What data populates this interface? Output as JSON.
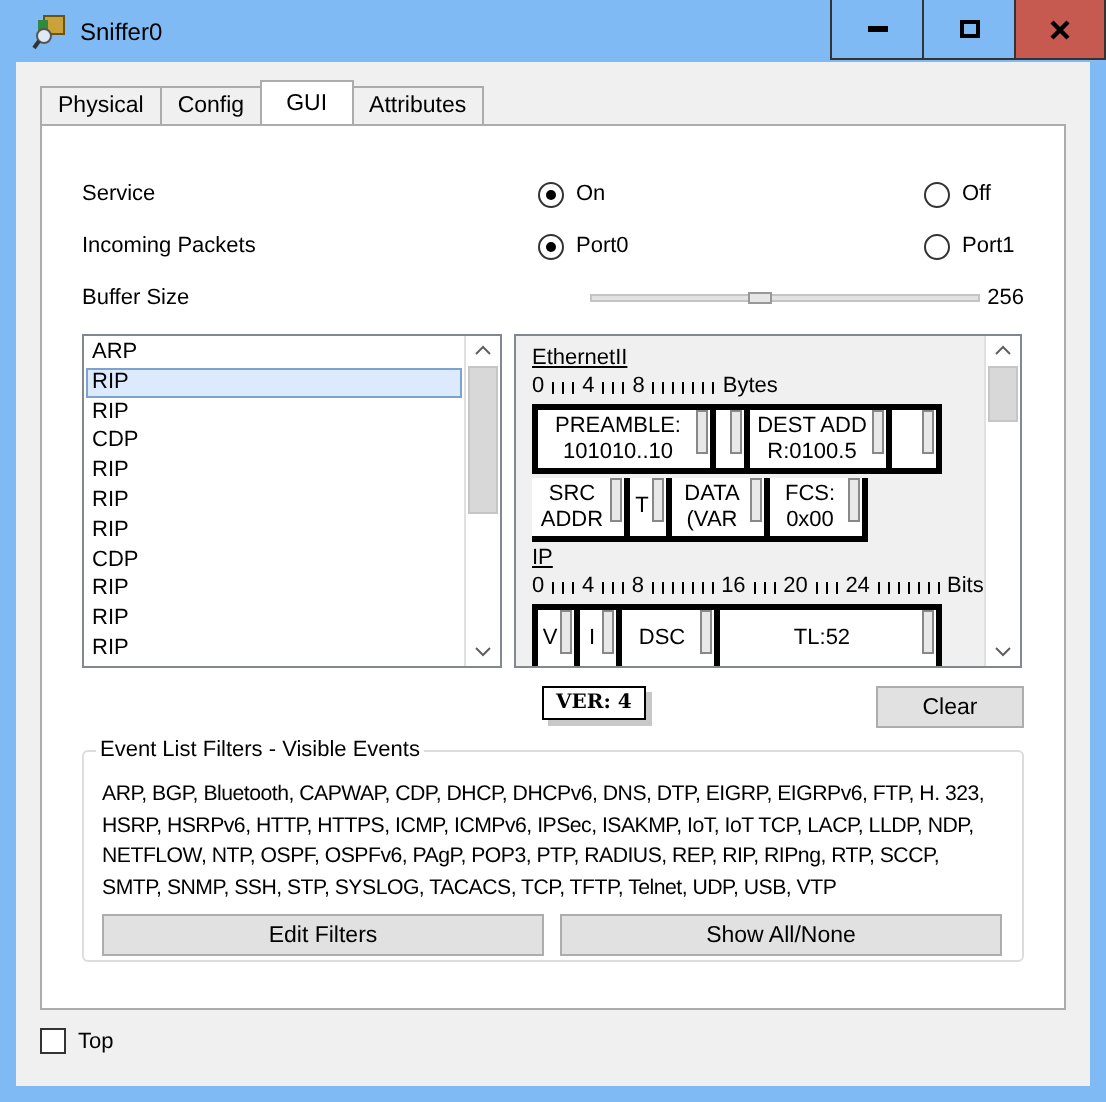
{
  "window": {
    "title": "Sniffer0"
  },
  "tabs": [
    {
      "label": "Physical",
      "selected": false
    },
    {
      "label": "Config",
      "selected": false
    },
    {
      "label": "GUI",
      "selected": true
    },
    {
      "label": "Attributes",
      "selected": false
    }
  ],
  "service": {
    "label": "Service",
    "options": [
      {
        "label": "On",
        "selected": true
      },
      {
        "label": "Off",
        "selected": false
      }
    ]
  },
  "incoming_packets": {
    "label": "Incoming Packets",
    "options": [
      {
        "label": "Port0",
        "selected": true
      },
      {
        "label": "Port1",
        "selected": false
      }
    ]
  },
  "buffer_size": {
    "label": "Buffer Size",
    "level": 0.44,
    "reading": "256"
  },
  "event_list": [
    {
      "label": "ARP",
      "selected": false
    },
    {
      "label": "RIP",
      "selected": true
    },
    {
      "label": "RIP",
      "selected": false
    },
    {
      "label": "CDP",
      "selected": false
    },
    {
      "label": "RIP",
      "selected": false
    },
    {
      "label": "RIP",
      "selected": false
    },
    {
      "label": "RIP",
      "selected": false
    },
    {
      "label": "CDP",
      "selected": false
    },
    {
      "label": "RIP",
      "selected": false
    },
    {
      "label": "RIP",
      "selected": false
    },
    {
      "label": "RIP",
      "selected": false
    }
  ],
  "packet_detail": {
    "layers": [
      {
        "name": "EthernetII",
        "ruler": [
          "0",
          "4",
          "8"
        ],
        "unit": "Bytes",
        "rows": [
          {
            "framed": true,
            "fields": [
              {
                "kind": "long",
                "lines": [
                  "PREAMBLE:",
                  "101010..10"
                ]
              },
              {
                "kind": "stub"
              },
              {
                "kind": "mid",
                "lines": [
                  "DEST ADD",
                  "R:0100.5"
                ]
              },
              {
                "kind": "blank"
              }
            ]
          },
          {
            "framed": false,
            "fields": [
              {
                "kind": "small",
                "lines": [
                  "SRC",
                  "ADDR"
                ]
              },
              {
                "kind": "slim",
                "lines": [
                  "T"
                ]
              },
              {
                "kind": "small",
                "lines": [
                  "DATA",
                  "(VAR"
                ]
              },
              {
                "kind": "small",
                "lines": [
                  "FCS:",
                  "0x00"
                ]
              }
            ]
          }
        ]
      },
      {
        "name": "IP",
        "ruler": [
          "0",
          "4",
          "8",
          "16",
          "20",
          "24"
        ],
        "unit": "Bits",
        "rows": [
          {
            "framed": true,
            "fields": [
              {
                "kind": "slim",
                "lines": [
                  "V"
                ]
              },
              {
                "kind": "slim",
                "lines": [
                  "I"
                ]
              },
              {
                "kind": "small",
                "lines": [
                  "DSC"
                ]
              },
              {
                "kind": "wide",
                "lines": [
                  "TL:52"
                ]
              }
            ]
          }
        ]
      }
    ]
  },
  "tooltip": "VER: 4",
  "clear_button": "Clear",
  "filters": {
    "legend": "Event List Filters - Visible Events",
    "text": "ARP, BGP, Bluetooth, CAPWAP, CDP, DHCP, DHCPv6, DNS, DTP, EIGRP, EIGRPv6, FTP, H. 323, HSRP, HSRPv6, HTTP, HTTPS, ICMP, ICMPv6, IPSec, ISAKMP, IoT, IoT TCP, LACP, LLDP, NDP, NETFLOW, NTP, OSPF, OSPFv6, PAgP, POP3, PTP, RADIUS, REP, RIP, RIPng, RTP, SCCP, SMTP, SNMP, SSH, STP, SYSLOG, TACACS, TCP, TFTP, Telnet, UDP, USB, VTP",
    "buttons": [
      "Edit Filters",
      "Show All/None"
    ]
  },
  "top": {
    "label": "Top",
    "checked": false
  }
}
